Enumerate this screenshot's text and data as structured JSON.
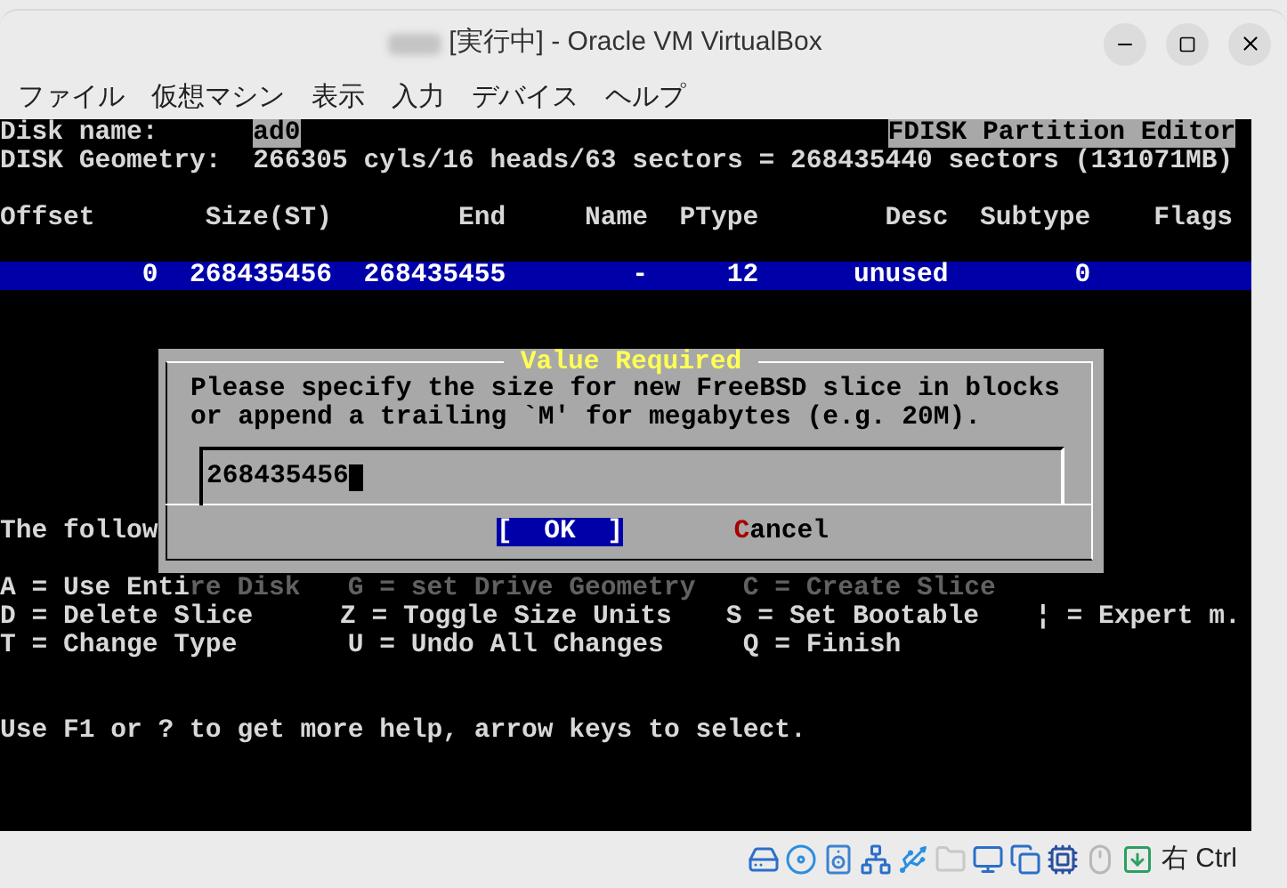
{
  "window": {
    "title": "[実行中] - Oracle VM VirtualBox"
  },
  "menu": [
    "ファイル",
    "仮想マシン",
    "表示",
    "入力",
    "デバイス",
    "ヘルプ"
  ],
  "terminal": {
    "disk_name_label": "Disk name:",
    "disk_name": "ad0",
    "editor_title": "FDISK Partition Editor",
    "geometry": "DISK Geometry:  266305 cyls/16 heads/63 sectors = 268435440 sectors (131071MB)",
    "columns": [
      "Offset",
      "Size(ST)",
      "End",
      "Name",
      "PType",
      "Desc",
      "Subtype",
      "Flags"
    ],
    "partitions": [
      {
        "cells": [
          "0",
          "268435456",
          "268435455",
          "-",
          "12",
          "unused",
          "0"
        ],
        "selected": true
      }
    ],
    "partial_line": "The follow",
    "commands": [
      [
        "A = Use Entire Disk",
        "G = set Drive Geometry",
        "C = Create Slice"
      ],
      [
        "D = Delete Slice",
        "Z = Toggle Size Units",
        "S = Set Bootable",
        "¦ = Expert m."
      ],
      [
        "T = Change Type",
        "U = Undo All Changes",
        "Q = Finish"
      ]
    ],
    "help": "Use F1 or ? to get more help, arrow keys to select."
  },
  "dialog": {
    "title": "Value Required",
    "message": [
      "Please specify the size for new FreeBSD slice in blocks",
      "or append a trailing `M' for megabytes (e.g. 20M)."
    ],
    "value": "268435456",
    "buttons": [
      {
        "label": "[  OK  ]",
        "selected": true
      },
      {
        "label": "Cancel",
        "selected": false
      }
    ]
  },
  "status_bar": {
    "host_key": "右 Ctrl"
  }
}
